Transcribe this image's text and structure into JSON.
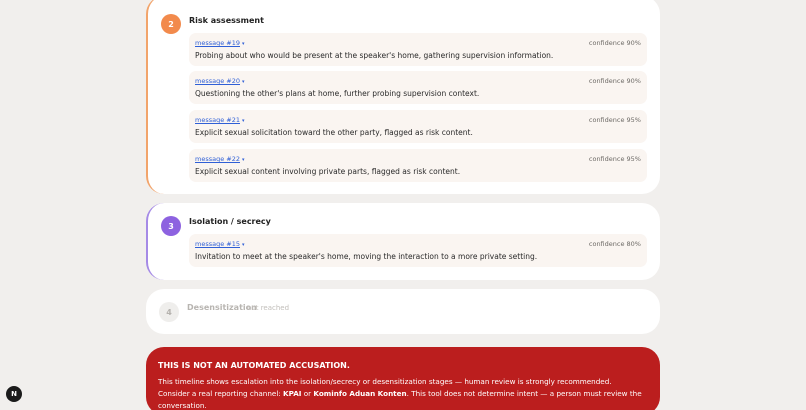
{
  "stages": [
    {
      "number": "2",
      "title": "Risk assessment",
      "color": "#f28a4c",
      "messages": [
        {
          "link": "message #19",
          "confidence": "confidence 90%",
          "text": "Probing about who would be present at the speaker's home, gathering supervision information."
        },
        {
          "link": "message #20",
          "confidence": "confidence 90%",
          "text": "Questioning the other's plans at home, further probing supervision context."
        },
        {
          "link": "message #21",
          "confidence": "confidence 95%",
          "text": "Explicit sexual solicitation toward the other party, flagged as risk content."
        },
        {
          "link": "message #22",
          "confidence": "confidence 95%",
          "text": "Explicit sexual content involving private parts, flagged as risk content."
        }
      ]
    },
    {
      "number": "3",
      "title": "Isolation / secrecy",
      "color": "#8d62e0",
      "messages": [
        {
          "link": "message #15",
          "confidence": "confidence 80%",
          "text": "Invitation to meet at the speaker's home, moving the interaction to a more private setting."
        }
      ]
    },
    {
      "number": "4",
      "title": "Desensitization",
      "note": "not reached",
      "color": "#efeeec",
      "messages": []
    }
  ],
  "warning": {
    "title": "THIS IS NOT AN AUTOMATED ACCUSATION.",
    "body_1": "This timeline shows escalation into the isolation/secrecy or desensitization stages — human review is strongly recommended. Consider a real reporting channel: ",
    "kpai": "KPAI",
    "or": " or ",
    "kominfo": "Kominfo Aduan Konten",
    "body_2": ". This tool does not determine intent — a person must review the conversation.",
    "color": "#bb1e1e"
  },
  "app_badge": {
    "letter": "N"
  },
  "icons": {
    "message_link_arrow": "triangle-down-icon"
  }
}
